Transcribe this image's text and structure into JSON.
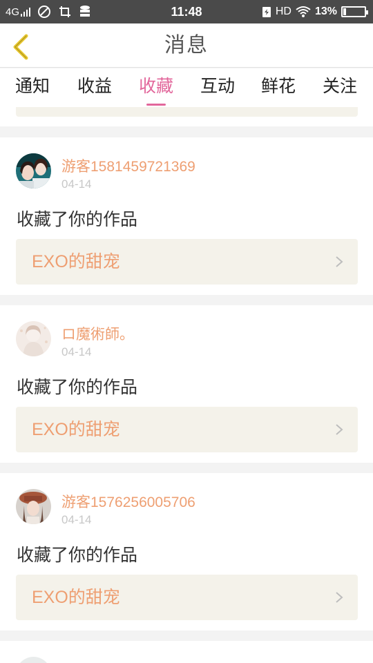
{
  "status_bar": {
    "network": "4G",
    "time": "11:48",
    "hd": "HD",
    "battery_percent": "13%",
    "battery_level": 0.13
  },
  "header": {
    "title": "消息",
    "back_icon": "chevron-left-icon"
  },
  "tabs": [
    {
      "label": "通知",
      "active": false
    },
    {
      "label": "收益",
      "active": false
    },
    {
      "label": "收藏",
      "active": true
    },
    {
      "label": "互动",
      "active": false
    },
    {
      "label": "鲜花",
      "active": false
    },
    {
      "label": "关注",
      "active": false
    }
  ],
  "messages": [
    {
      "user": "游客1581459721369",
      "date": "04-14",
      "action": "收藏了你的作品",
      "work": "EXO的甜宠"
    },
    {
      "user": "ロ魔術師。",
      "date": "04-14",
      "action": "收藏了你的作品",
      "work": "EXO的甜宠"
    },
    {
      "user": "游客1576256005706",
      "date": "04-14",
      "action": "收藏了你的作品",
      "work": "EXO的甜宠"
    }
  ],
  "colors": {
    "accent": "#e2679b",
    "username": "#ee9f72",
    "work_bg": "#f4f2ea"
  }
}
